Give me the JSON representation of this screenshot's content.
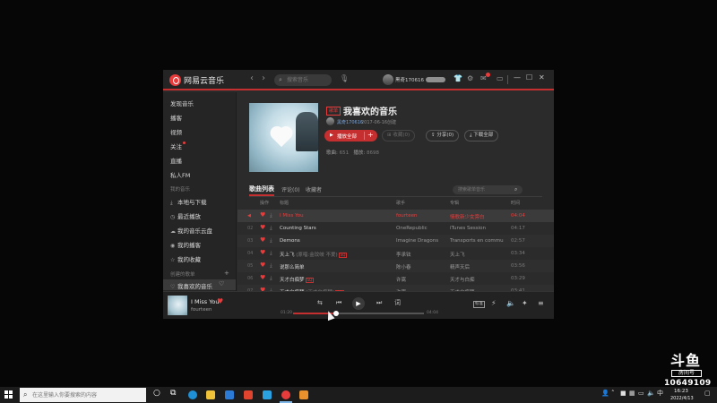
{
  "app": {
    "title": "网易云音乐",
    "search_placeholder": "搜索音乐",
    "username": "黑奇170616",
    "accent": "#c62f2f"
  },
  "sidebar": {
    "items": [
      {
        "label": "发现音乐"
      },
      {
        "label": "播客"
      },
      {
        "label": "视频"
      },
      {
        "label": "关注"
      },
      {
        "label": "直播"
      },
      {
        "label": "私人FM"
      }
    ],
    "my_music_header": "我的音乐",
    "my_music": [
      {
        "label": "本地与下载",
        "icon": "download-icon"
      },
      {
        "label": "最近播放",
        "icon": "clock-icon"
      },
      {
        "label": "我的音乐云盘",
        "icon": "cloud-icon"
      },
      {
        "label": "我的播客",
        "icon": "podcast-icon"
      },
      {
        "label": "我的收藏",
        "icon": "star-icon"
      }
    ],
    "created_header": "创建的歌单",
    "created": [
      {
        "label": "我喜欢的音乐",
        "icon": "heart-icon"
      }
    ]
  },
  "playlist": {
    "tag": "歌单",
    "title": "我喜欢的音乐",
    "creator": "黑奇170616",
    "created_date": "2017-06-16创建",
    "play_all": "播放全部",
    "collect": "收藏(0)",
    "share": "分享(0)",
    "download_all": "下载全部",
    "songs_label": "歌曲",
    "songs_count": "651",
    "plays_label": "播放",
    "plays_count": "8698"
  },
  "tabs": [
    {
      "label": "歌曲列表"
    },
    {
      "label": "评论(0)"
    },
    {
      "label": "收藏者"
    }
  ],
  "list_search_placeholder": "搜索歌单音乐",
  "table": {
    "headers": {
      "op": "操作",
      "title": "标题",
      "artist": "歌手",
      "album": "专辑",
      "duration": "时间"
    },
    "rows": [
      {
        "idx": "",
        "title": "I Miss You",
        "sub": "",
        "badge": "",
        "artist": "fourteen",
        "album": "情歌新少女旁白",
        "duration": "04:04",
        "playing": true
      },
      {
        "idx": "02",
        "title": "Counting Stars",
        "sub": "",
        "badge": "",
        "artist": "OneRepublic",
        "album": "iTunes Session",
        "duration": "04:17",
        "playing": false
      },
      {
        "idx": "03",
        "title": "Demons",
        "sub": "",
        "badge": "",
        "artist": "Imagine Dragons",
        "album": "Transports en commun",
        "duration": "02:57",
        "playing": false
      },
      {
        "idx": "04",
        "title": "天上飞",
        "sub": " (原唱:金玟岐 不爱)",
        "badge": "SQ",
        "artist": "李承铉",
        "album": "天上飞",
        "duration": "03:34",
        "playing": false
      },
      {
        "idx": "05",
        "title": "说那么简单",
        "sub": "",
        "badge": "",
        "artist": "陈小春",
        "album": "精声天后",
        "duration": "03:56",
        "playing": false
      },
      {
        "idx": "06",
        "title": "天才白痴梦",
        "sub": "",
        "badge": "SQ",
        "artist": "许嵩",
        "album": "天才与白痴",
        "duration": "03:29",
        "playing": false
      },
      {
        "idx": "07",
        "title": "天才白痴梦",
        "sub": " (天才白痴梦)",
        "badge": "SQ",
        "artist": "许嵩",
        "album": "天才白痴梦",
        "duration": "03:41",
        "playing": false
      }
    ]
  },
  "player": {
    "title": "I Miss You",
    "artist": "fourteen",
    "current_time": "01:20",
    "total_time": "04:04",
    "progress_pct": 33,
    "quality": "标准"
  },
  "watermark": {
    "logo": "斗鱼",
    "room_label": "房间号",
    "room_number": "10649109"
  },
  "taskbar": {
    "search_placeholder": "在这里输入你要搜索的内容",
    "time": "16:23",
    "date": "2022/4/13"
  }
}
